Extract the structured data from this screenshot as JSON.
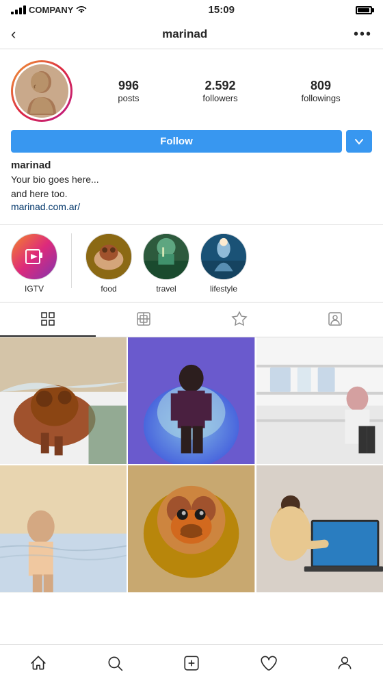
{
  "statusBar": {
    "carrier": "COMPANY",
    "time": "15:09"
  },
  "topNav": {
    "backLabel": "‹",
    "title": "marinad",
    "moreLabel": "•••"
  },
  "profile": {
    "username": "marinad",
    "stats": {
      "posts": {
        "value": "996",
        "label": "posts"
      },
      "followers": {
        "value": "2.592",
        "label": "followers"
      },
      "followings": {
        "value": "809",
        "label": "followings"
      }
    },
    "followButton": "Follow",
    "bio": {
      "name": "marinad",
      "line1": "Your bio goes here...",
      "line2": "and here too.",
      "link": "marinad.com.ar/"
    }
  },
  "highlights": [
    {
      "id": "igtv",
      "label": "IGTV",
      "type": "igtv"
    },
    {
      "id": "food",
      "label": "food",
      "type": "food"
    },
    {
      "id": "travel",
      "label": "travel",
      "type": "travel"
    },
    {
      "id": "lifestyle",
      "label": "lifestyle",
      "type": "lifestyle"
    }
  ],
  "tabs": [
    {
      "id": "grid",
      "label": "Grid",
      "active": true
    },
    {
      "id": "reels",
      "label": "Reels",
      "active": false
    },
    {
      "id": "tagged",
      "label": "Tagged",
      "active": false
    },
    {
      "id": "profile",
      "label": "Profile",
      "active": false
    }
  ],
  "gridImages": [
    {
      "id": "img1",
      "colors": [
        "#8B6914",
        "#c4a882",
        "#a0522d",
        "#d2b48c"
      ]
    },
    {
      "id": "img2",
      "colors": [
        "#4169e1",
        "#87ceeb",
        "#6a0dad",
        "#9b59b6"
      ]
    },
    {
      "id": "img3",
      "colors": [
        "#f5f5f5",
        "#dcdcdc",
        "#b0c4de",
        "#778899"
      ]
    },
    {
      "id": "img4",
      "colors": [
        "#f5deb3",
        "#deb887",
        "#ffe4b5",
        "#faf0e6"
      ]
    },
    {
      "id": "img5",
      "colors": [
        "#8b6914",
        "#a0522d",
        "#cd853f",
        "#d2691e"
      ]
    },
    {
      "id": "img6",
      "colors": [
        "#c0c0c0",
        "#708090",
        "#2f4f4f",
        "#1c1c1c"
      ]
    }
  ],
  "bottomNav": {
    "items": [
      "home",
      "search",
      "add",
      "heart",
      "profile"
    ]
  }
}
